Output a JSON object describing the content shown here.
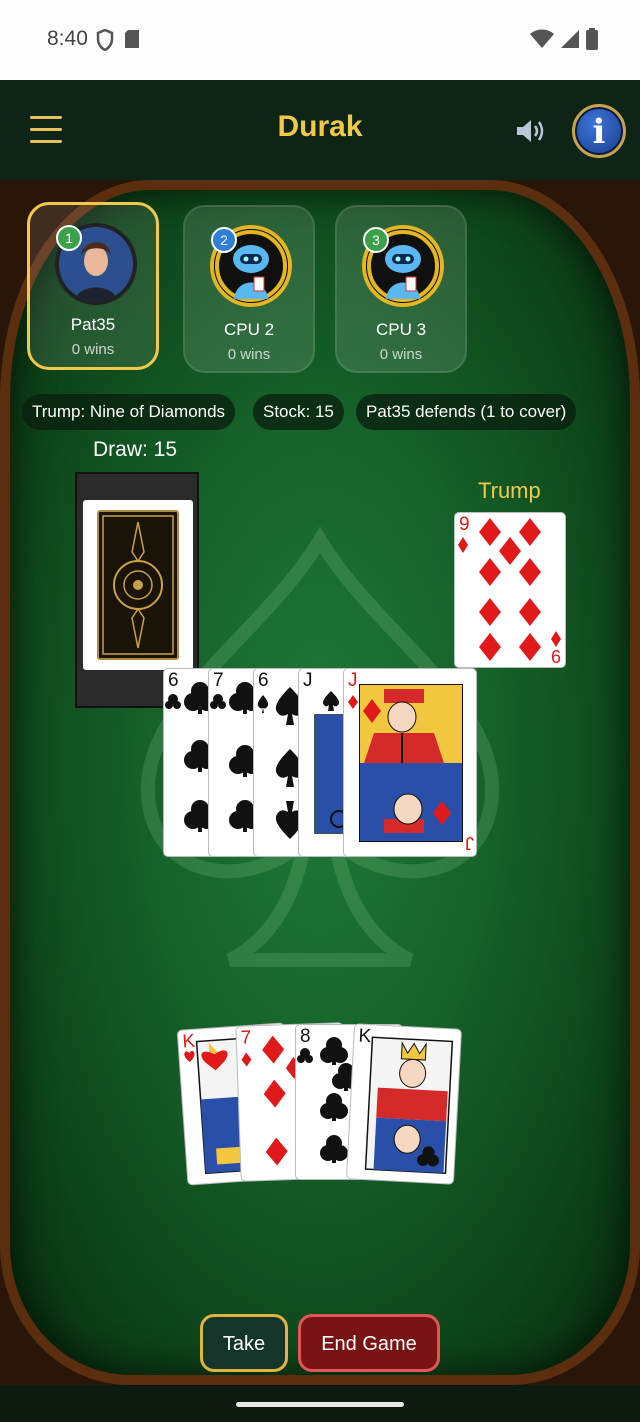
{
  "status": {
    "time": "8:40"
  },
  "app": {
    "title": "Durak",
    "menu_icon": "hamburger-icon",
    "sound_icon": "speaker-icon",
    "info_icon": "info-icon"
  },
  "players": [
    {
      "badge": "1",
      "name": "Pat35",
      "wins": "0 wins",
      "active": true,
      "badge_color": "#3aa14a"
    },
    {
      "badge": "2",
      "name": "CPU 2",
      "wins": "0 wins",
      "active": false,
      "badge_color": "#2f7fd6"
    },
    {
      "badge": "3",
      "name": "CPU 3",
      "wins": "0 wins",
      "active": false,
      "badge_color": "#3aa14a"
    }
  ],
  "info": {
    "trump": "Trump: Nine of Diamonds",
    "stock": "Stock: 15",
    "defense": "Pat35 defends (1 to cover)"
  },
  "deck": {
    "label": "Draw: 15"
  },
  "trump_card": {
    "label": "Trump",
    "rank": "9",
    "suit": "diamonds"
  },
  "table_cards": [
    {
      "rank": "6",
      "suit": "clubs"
    },
    {
      "rank": "7",
      "suit": "clubs"
    },
    {
      "rank": "6",
      "suit": "spades"
    },
    {
      "rank": "J",
      "suit": "spades"
    },
    {
      "rank": "J",
      "suit": "diamonds"
    }
  ],
  "hand": [
    {
      "rank": "K",
      "suit": "hearts"
    },
    {
      "rank": "7",
      "suit": "diamonds"
    },
    {
      "rank": "8",
      "suit": "clubs"
    },
    {
      "rank": "K",
      "suit": "clubs"
    }
  ],
  "actions": {
    "take": "Take",
    "end_game": "End Game"
  },
  "colors": {
    "accent": "#f1c84b",
    "felt": "#16612a",
    "danger": "#7a1414"
  }
}
